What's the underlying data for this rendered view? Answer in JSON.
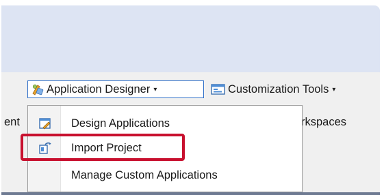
{
  "toolbar": {
    "application_designer_label": "Application Designer",
    "customization_tools_label": "Customization Tools",
    "left_fragment": "ent",
    "right_fragment": "rkspaces",
    "caret": "▾"
  },
  "menu": {
    "items": [
      {
        "label": "Design Applications",
        "icon": "design-applications-icon"
      },
      {
        "label": "Import Project",
        "icon": "import-project-icon",
        "highlighted": true
      },
      {
        "label": "Manage Custom Applications",
        "icon": null
      }
    ]
  },
  "colors": {
    "highlight": "#c8102e",
    "band": "#dde4f3",
    "dropdown_border": "#2f6fc8"
  }
}
